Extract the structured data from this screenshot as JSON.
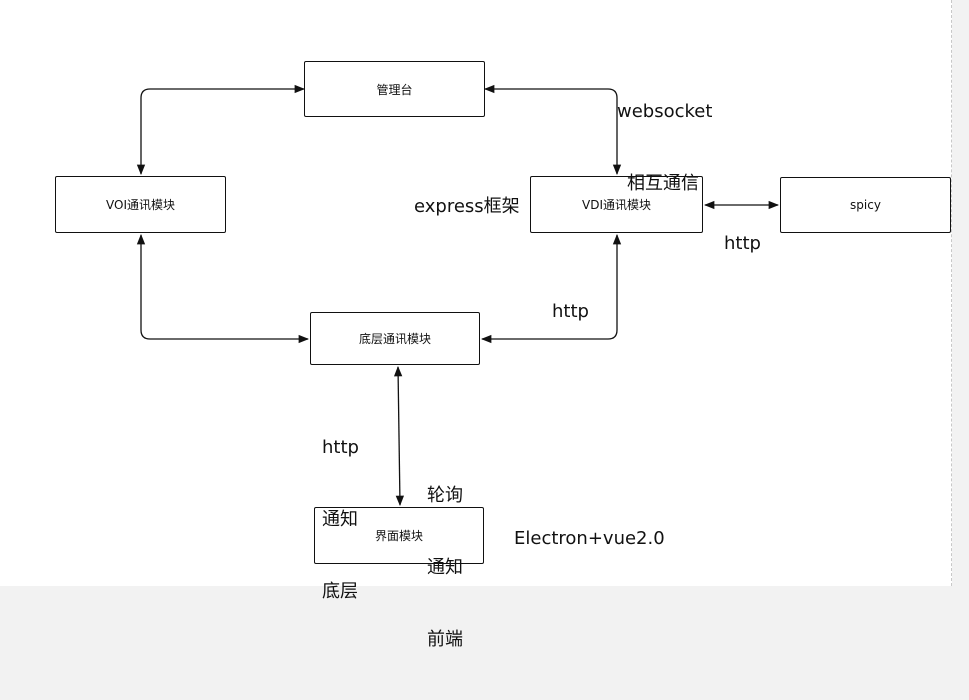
{
  "nodes": {
    "console": "管理台",
    "voi": "VOI通讯模块",
    "vdi": "VDI通讯模块",
    "spicy": "spicy",
    "bottom": "底层通讯模块",
    "ui": "界面模块"
  },
  "labels": {
    "websocket_line1": "websocket",
    "websocket_line2": "相互通信",
    "express": "express框架",
    "http_spicy": "http",
    "http_vdi_bottom": "http",
    "http_notify_line1": "http",
    "http_notify_line2": "通知",
    "http_notify_line3": "底层",
    "poll_line1": "轮询",
    "poll_line2": "通知",
    "poll_line3": "前端",
    "electron": "Electron+vue2.0"
  }
}
